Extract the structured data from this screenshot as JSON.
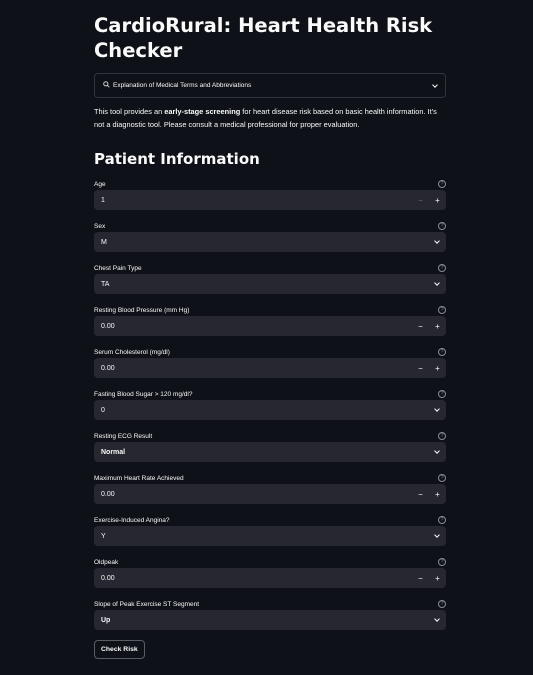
{
  "app": {
    "title": "CardioRural: Heart Health Risk Checker"
  },
  "expander": {
    "icon": "magnifier-icon",
    "label": "Explanation of Medical Terms and Abbreviations"
  },
  "intro": {
    "before": "This tool provides an ",
    "bold": "early-stage screening",
    "after": " for heart disease risk based on basic health information. It's not a diagnostic tool. Please consult a medical professional for proper evaluation."
  },
  "section": {
    "title": "Patient Information"
  },
  "fields": {
    "age": {
      "label": "Age",
      "value": "1"
    },
    "sex": {
      "label": "Sex",
      "value": "M"
    },
    "chest_pain": {
      "label": "Chest Pain Type",
      "value": "TA"
    },
    "resting_bp": {
      "label": "Resting Blood Pressure (mm Hg)",
      "value": "0.00"
    },
    "cholesterol": {
      "label": "Serum Cholesterol (mg/dl)",
      "value": "0.00"
    },
    "fasting_bs": {
      "label": "Fasting Blood Sugar > 120 mg/dl?",
      "value": "0"
    },
    "resting_ecg": {
      "label": "Resting ECG Result",
      "value": "Normal"
    },
    "max_hr": {
      "label": "Maximum Heart Rate Achieved",
      "value": "0.00"
    },
    "angina": {
      "label": "Exercise-Induced Angina?",
      "value": "Y"
    },
    "oldpeak": {
      "label": "Oldpeak",
      "value": "0.00"
    },
    "st_slope": {
      "label": "Slope of Peak Exercise ST Segment",
      "value": "Up"
    }
  },
  "controls": {
    "minus": "−",
    "plus": "+",
    "help": "?"
  },
  "button": {
    "label": "Check Risk"
  }
}
